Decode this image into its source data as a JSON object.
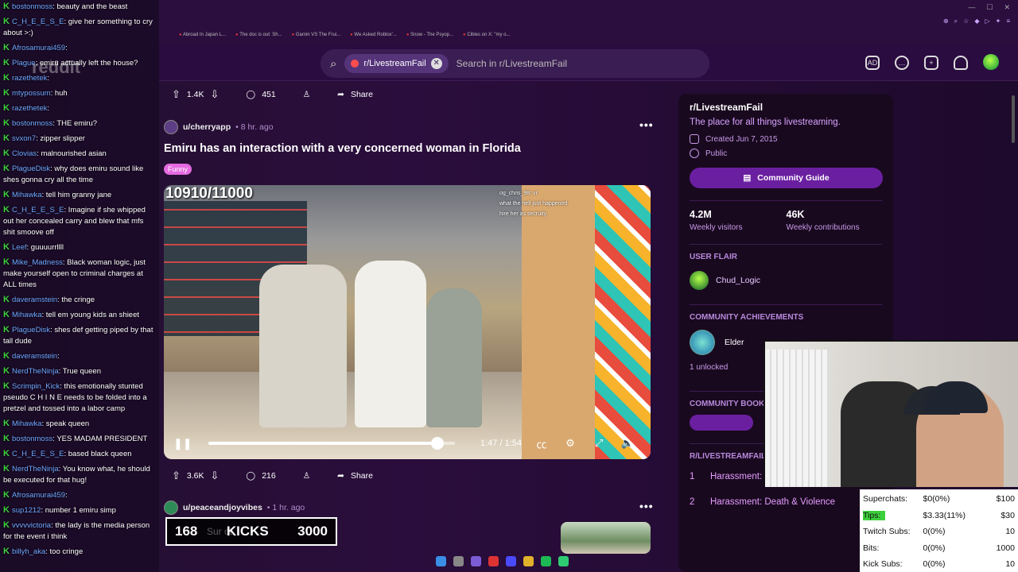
{
  "chat": [
    {
      "user": "bostonmoss",
      "text": "beauty and the beast"
    },
    {
      "user": "C_H_E_E_S_E",
      "text": "give her something to cry about >:)"
    },
    {
      "user": "Afrosamurai459",
      "text": ""
    },
    {
      "user": "Plague",
      "text": "emiru actually left the house?"
    },
    {
      "user": "razethetek",
      "text": ""
    },
    {
      "user": "mtypossum",
      "text": "huh"
    },
    {
      "user": "razethetek",
      "text": ""
    },
    {
      "user": "bostonmoss",
      "text": "THE emiru?"
    },
    {
      "user": "svxon7",
      "text": "zipper slipper"
    },
    {
      "user": "Clovias",
      "text": "malnourished asian"
    },
    {
      "user": "PlagueDisk",
      "text": "why does emiru sound like shes gonna cry all the time"
    },
    {
      "user": "Mihawka",
      "text": "tell him granny jane"
    },
    {
      "user": "C_H_E_E_S_E",
      "text": "Imagine if she whipped out her concealed carry and blew that mfs shit smoove off"
    },
    {
      "user": "Leef",
      "text": "guuuurrllll"
    },
    {
      "user": "Mike_Madness",
      "text": "Black woman logic, just make yourself open to criminal charges at ALL times"
    },
    {
      "user": "daveramstein",
      "text": "the cringe"
    },
    {
      "user": "Mihawka",
      "text": "tell em young kids an shieet"
    },
    {
      "user": "PlagueDisk",
      "text": "shes def getting piped by that tall dude"
    },
    {
      "user": "daveramstein",
      "text": ""
    },
    {
      "user": "NerdTheNinja",
      "text": "True queen"
    },
    {
      "user": "Scrimpin_Kick",
      "text": "this emotionally stunted pseudo C H I N E needs to be folded into a pretzel and tossed into a labor camp"
    },
    {
      "user": "Mihawka",
      "text": "speak queen"
    },
    {
      "user": "bostonmoss",
      "text": "YES MADAM PRESIDENT"
    },
    {
      "user": "C_H_E_E_S_E",
      "text": "based black queen"
    },
    {
      "user": "NerdTheNinja",
      "text": "You know what, he should be executed for that hug!"
    },
    {
      "user": "Afrosamurai459",
      "text": ""
    },
    {
      "user": "sup1212",
      "text": "number 1 emiru simp"
    },
    {
      "user": "vvvvvictoria",
      "text": "the lady is the media person for the event i think"
    },
    {
      "user": "billyh_aka",
      "text": "too cringe"
    }
  ],
  "bookmarks": [
    "Abroad In Japan L...",
    "The doc is out: Sh...",
    "Gamin VS The Frui...",
    "We Asked Roblox'...",
    "Snow - The Psyop...",
    "Cibles on X: \"my o..."
  ],
  "header": {
    "logo": "reddit",
    "search_chip": "r/LivestreamFail",
    "search_placeholder": "Search in r/LivestreamFail"
  },
  "post_prev": {
    "votes": "1.4K",
    "comments": "451",
    "share": "Share"
  },
  "post": {
    "user": "u/cherryapp",
    "time": "8 hr. ago",
    "title": "Emiru has an interaction with a very concerned woman in Florida",
    "flair": "Funny",
    "counter": "10910/11000",
    "vchat1": "og_chris_98: vr",
    "vchat2": "what the hell just happened",
    "vchat3": "hire her as secruity",
    "time_display": "1:47 / 1:54",
    "progress": 0.93,
    "votes": "3.6K",
    "comments": "216",
    "share": "Share"
  },
  "post2": {
    "user": "u/peaceandjoyvibes",
    "time": "1 hr. ago"
  },
  "kicks": {
    "left": "168",
    "label": "KICKS",
    "goal": "3000",
    "faded": "Sur          ot"
  },
  "sidebar": {
    "name": "r/LivestreamFail",
    "desc": "The place for all things livestreaming.",
    "created": "Created Jun 7, 2015",
    "visibility": "Public",
    "guide": "Community Guide",
    "visitors_num": "4.2M",
    "visitors_lab": "Weekly visitors",
    "contrib_num": "46K",
    "contrib_lab": "Weekly contributions",
    "flair_head": "USER FLAIR",
    "flair_name": "Chud_Logic",
    "ach_head": "COMMUNITY ACHIEVEMENTS",
    "ach_name": "Elder",
    "ach_unlocked": "1 unlocked",
    "book_head": "COMMUNITY BOOK",
    "rules_head": "R/LIVESTREAMFAIL RULES",
    "rules": [
      {
        "n": "1",
        "t": "Harassment: Civility"
      },
      {
        "n": "2",
        "t": "Harassment: Death & Violence"
      }
    ]
  },
  "donations": [
    {
      "label": "Superchats:",
      "val": "$0(0%)",
      "goal": "$100"
    },
    {
      "label": "Tips:",
      "val": "$3.33(11%)",
      "goal": "$30"
    },
    {
      "label": "Twitch Subs:",
      "val": "0(0%)",
      "goal": "10"
    },
    {
      "label": "Bits:",
      "val": "0(0%)",
      "goal": "1000"
    },
    {
      "label": "Kick Subs:",
      "val": "0(0%)",
      "goal": "10"
    }
  ],
  "colors": {
    "accent": "#6a1fa0",
    "bg": "#2a0c40",
    "tips": "#3dd03d"
  }
}
